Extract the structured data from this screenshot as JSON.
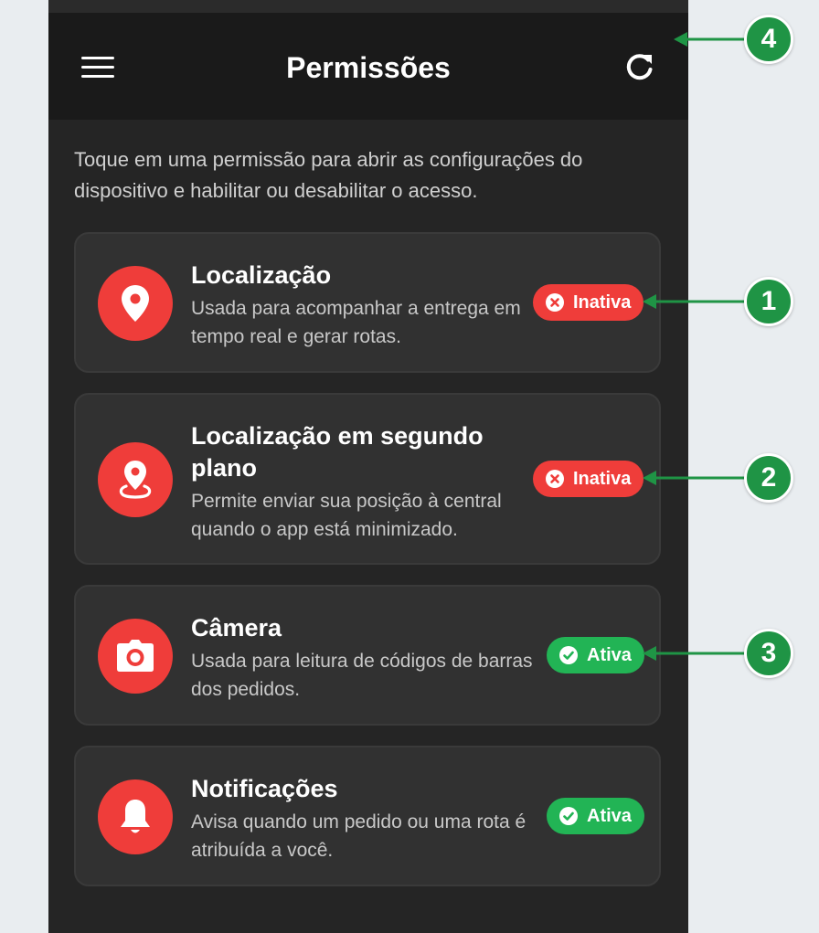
{
  "header": {
    "title": "Permissões"
  },
  "intro": "Toque em uma permissão para abrir as configurações do dispositivo e habilitar ou desabilitar o acesso.",
  "permissions": [
    {
      "title": "Localização",
      "description": "Usada para acompanhar a entrega em tempo real e gerar rotas.",
      "status": "Inativa",
      "icon": "location-pin-icon"
    },
    {
      "title": "Localização em segundo plano",
      "description": "Permite enviar sua posição à central quando o app está minimizado.",
      "status": "Inativa",
      "icon": "background-location-icon"
    },
    {
      "title": "Câmera",
      "description": "Usada para leitura de códigos de barras dos pedidos.",
      "status": "Ativa",
      "icon": "camera-icon"
    },
    {
      "title": "Notificações",
      "description": "Avisa quando um pedido ou uma rota é atribuída a você.",
      "status": "Ativa",
      "icon": "bell-icon"
    }
  ],
  "annotations": [
    "1",
    "2",
    "3",
    "4"
  ],
  "colors": {
    "accent_red": "#ef3d3a",
    "active_green": "#22b455",
    "annotation_green": "#1f9445",
    "app_bar": "#1a1a1a",
    "background": "#252525"
  }
}
